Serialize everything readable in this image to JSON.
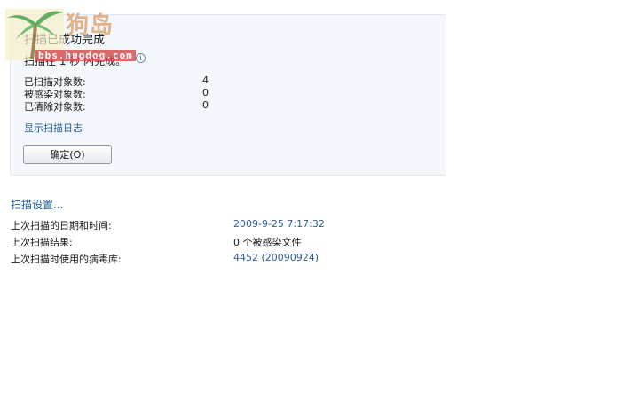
{
  "scan": {
    "title": "扫描已成功完成",
    "subtitle": "扫描在 1 秒 内完成。",
    "stats": [
      {
        "label": "已扫描对象数:",
        "value": "4"
      },
      {
        "label": "被感染对象数:",
        "value": "0"
      },
      {
        "label": "已清除对象数:",
        "value": "0"
      }
    ],
    "log_link": "显示扫描日志",
    "ok_button": "确定(O)"
  },
  "settings_link": "扫描设置...",
  "last_scan": [
    {
      "label": "上次扫描的日期和时间:",
      "value": "2009-9-25 7:17:32"
    },
    {
      "label": "上次扫描结果:",
      "value": "0 个被感染文件"
    },
    {
      "label": "上次扫描时使用的病毒库:",
      "value": "4452 (20090924)"
    }
  ],
  "watermark": {
    "text": "狗岛",
    "url": "bbs.hugdog.com"
  },
  "colors": {
    "link": "#1f5f9e",
    "panel_bg": "#f4f7fb",
    "value_blue": "#2a5d9e"
  },
  "icons": {
    "info": "info-icon"
  }
}
